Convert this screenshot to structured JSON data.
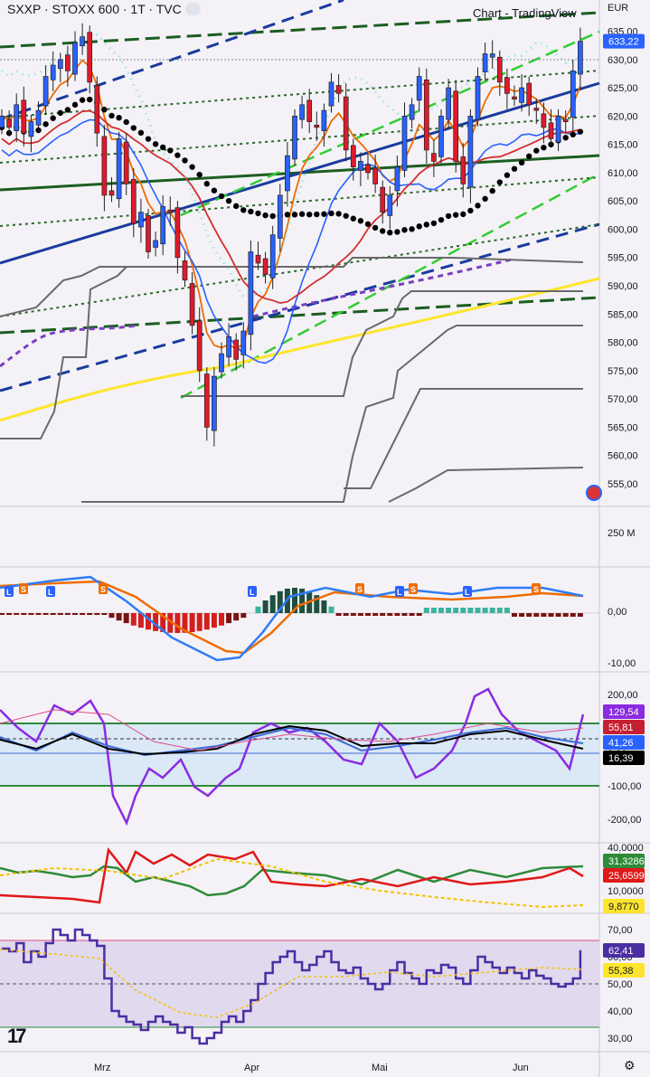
{
  "header": {
    "title": "SXXP · STOXX 600 · 1T · TVC",
    "brand": "Chart - TradingView",
    "currency": "EUR"
  },
  "colors": {
    "up": "#2962ff",
    "down": "#e0192c",
    "green_trend": "#1b5e20",
    "navy_trend": "#1a3b9e",
    "ma_black": "#000000",
    "ma_red": "#d32f2f",
    "ma_orange": "#ef6c00",
    "ma_blue": "#2962ff",
    "ma_yellow": "#fde52d",
    "macd_line": "#ef6c00",
    "signal_line": "#2e7cf6",
    "cci_purple": "#8a2be2",
    "adx_green": "#2e8b3a",
    "rsi_purple": "#4b2ea3"
  },
  "icons": [
    "eye-icon",
    "globe-icon",
    "tradingview-logo-icon",
    "settings-gear-icon"
  ],
  "chart_data": [
    {
      "type": "candlestick",
      "title": "SXXP · STOXX 600 · 1T · TVC",
      "ylim": [
        551,
        637
      ],
      "yticks": [
        "635,00",
        "630,00",
        "625,00",
        "620,00",
        "615,00",
        "610,00",
        "605,00",
        "600,00",
        "595,00",
        "590,00",
        "585,00",
        "580,00",
        "575,00",
        "570,00",
        "565,00",
        "560,00",
        "555,00"
      ],
      "last_price_label": "633,22",
      "x_labels": [
        "Mrz",
        "Apr",
        "Mai",
        "Jun"
      ],
      "close": [
        620,
        618,
        622,
        617,
        619,
        621,
        627,
        629,
        630,
        628,
        633,
        634,
        626,
        617,
        606,
        606,
        616,
        608,
        601,
        603,
        596,
        598,
        604,
        603,
        595,
        591,
        583,
        575,
        565,
        574,
        578,
        581,
        577,
        582,
        596,
        594,
        592,
        599,
        606,
        613,
        620,
        622,
        619,
        618,
        621,
        626,
        624,
        614,
        611,
        612,
        610,
        608,
        603,
        606,
        611,
        620,
        622,
        627,
        614,
        612,
        620,
        625,
        612,
        608,
        620,
        627,
        631,
        631,
        626,
        624,
        623,
        625,
        622,
        621,
        618,
        616,
        620,
        619,
        628,
        633.22
      ],
      "volume_axis_label": "250 M"
    },
    {
      "type": "macd",
      "yticks": [
        "0,00",
        "-10,00"
      ],
      "markers": [
        "L",
        "S",
        "L",
        "S",
        "L",
        "S",
        "L",
        "S",
        "L",
        "S"
      ]
    },
    {
      "type": "line",
      "name": "CCI",
      "yticks": [
        "200,00",
        "100,00",
        "0,00",
        "-100,00",
        "-200,00"
      ],
      "labels": [
        "129,54",
        "55,81",
        "41,26",
        "16,39"
      ]
    },
    {
      "type": "line",
      "name": "DMI/ADX",
      "yticks": [
        "40,0000",
        "30,0000",
        "20,0000",
        "10,0000"
      ],
      "labels": [
        "31,3286",
        "25,6599",
        "9,8770"
      ]
    },
    {
      "type": "line",
      "name": "RSI",
      "yticks": [
        "70,00",
        "60,00",
        "50,00",
        "40,00",
        "30,00"
      ],
      "labels": [
        "62,41",
        "55,38"
      ]
    }
  ]
}
